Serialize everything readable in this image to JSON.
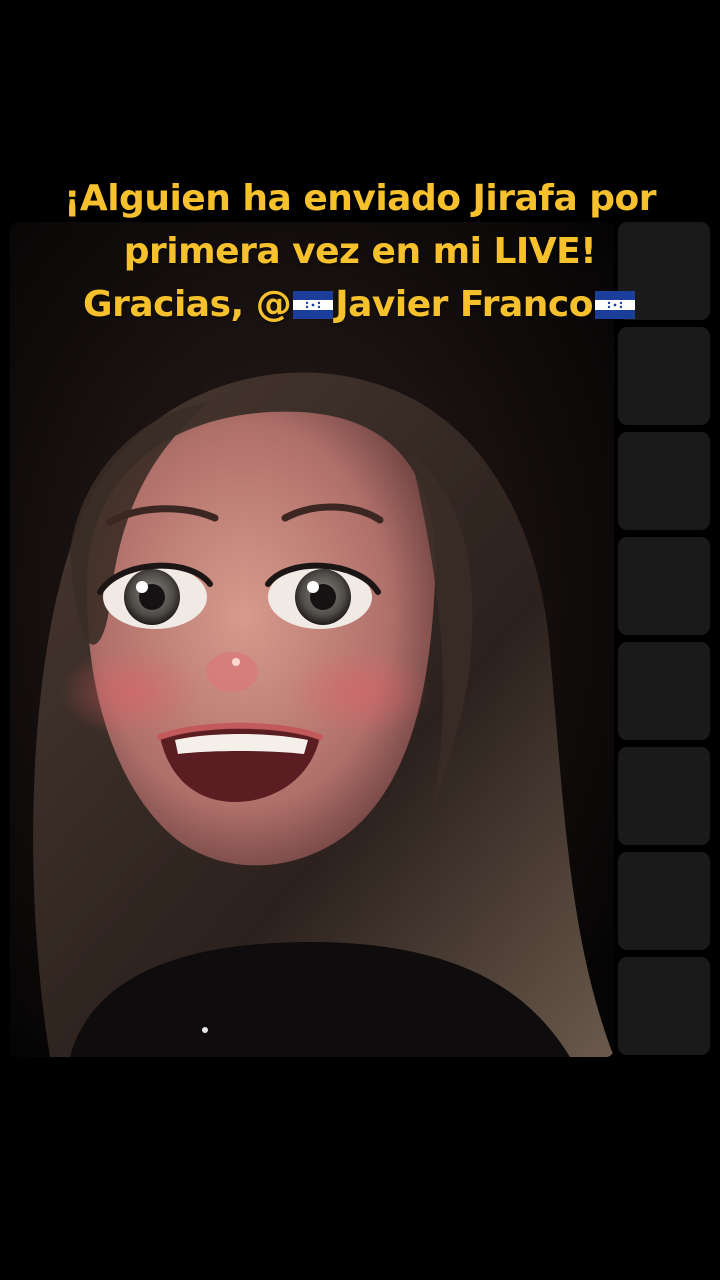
{
  "caption": {
    "line1": "¡Alguien ha enviado Jirafa por",
    "line2": "primera vez en mi LIVE!",
    "line3_prefix": "Gracias, @",
    "username": "Javier Franco",
    "flag_icon": "honduras-flag-icon",
    "color": "#F6C12C"
  },
  "video": {
    "subject": "avatar-face-filter-video"
  },
  "thumbnails": {
    "count": 8,
    "color": "#1A1A1A"
  },
  "colors": {
    "background": "#000000",
    "caption_text": "#F6C12C",
    "flag_blue": "#1A3E9A"
  }
}
